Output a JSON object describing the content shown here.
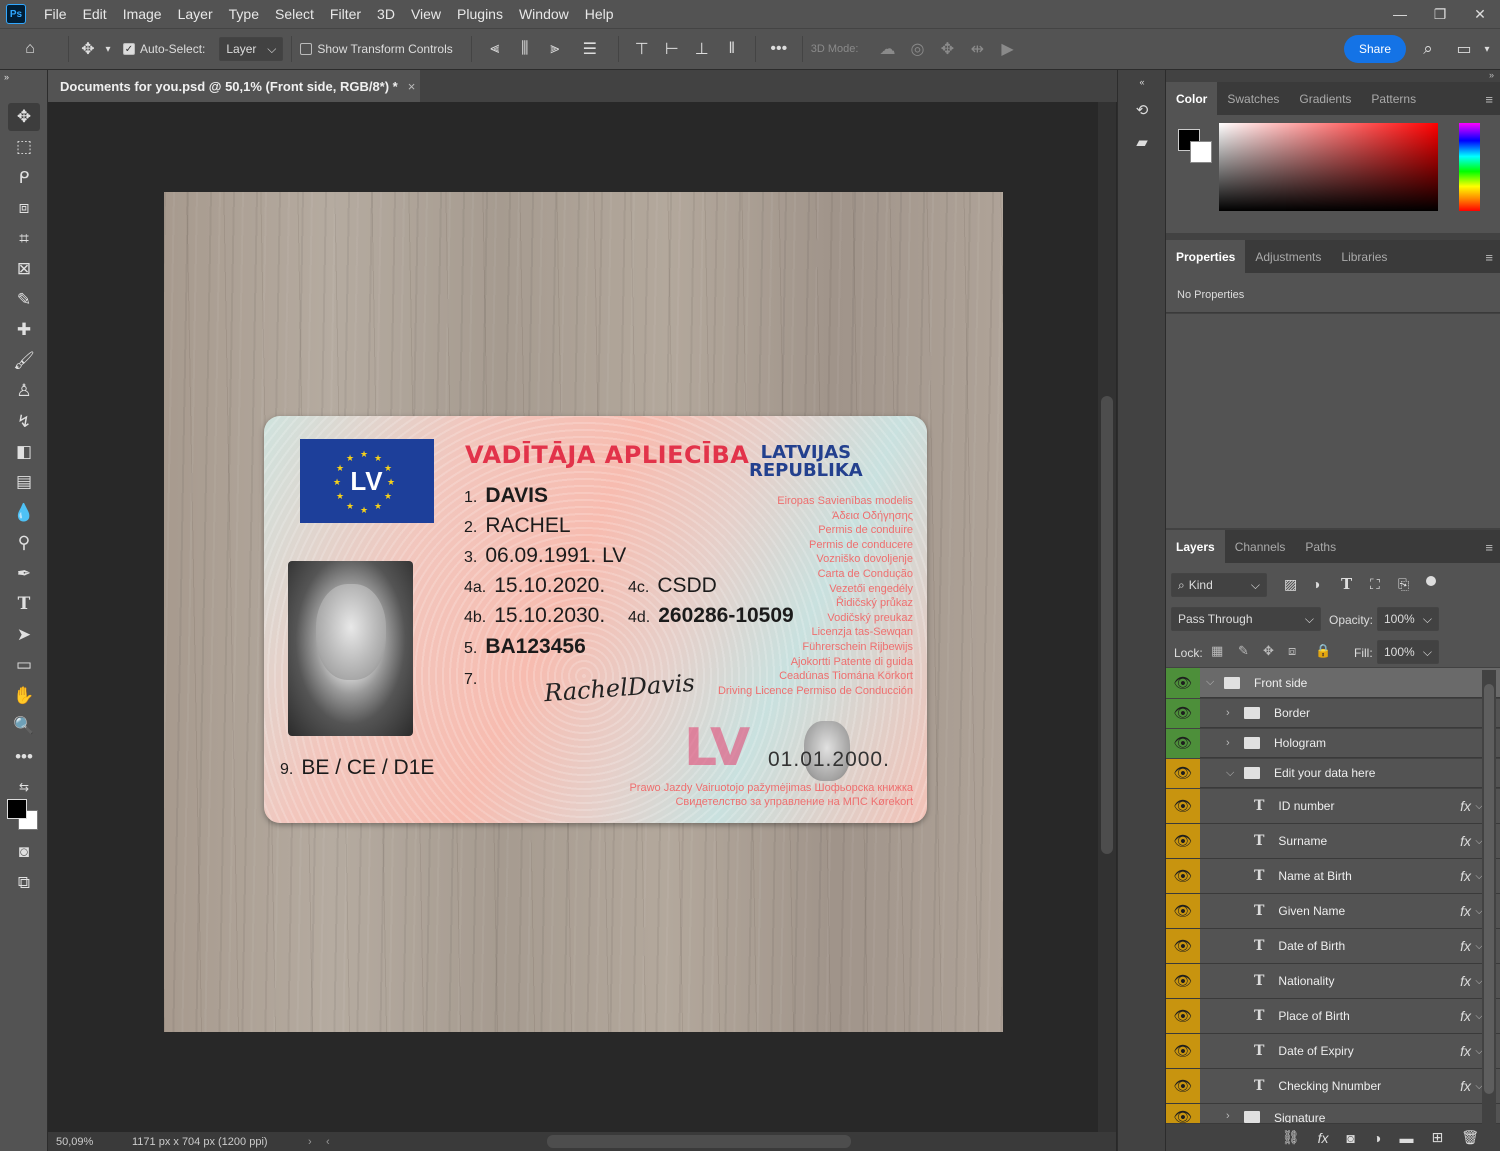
{
  "menubar": {
    "logo": "Ps",
    "items": [
      "File",
      "Edit",
      "Image",
      "Layer",
      "Type",
      "Select",
      "Filter",
      "3D",
      "View",
      "Plugins",
      "Window",
      "Help"
    ]
  },
  "options": {
    "auto_select_label": "Auto-Select:",
    "auto_select_value": "Layer",
    "show_transform_label": "Show Transform Controls",
    "mode3d_label": "3D Mode:",
    "share_label": "Share"
  },
  "document": {
    "tab_title": "Documents for you.psd @ 50,1% (Front side, RGB/8*) *",
    "zoom": "50,09%",
    "doc_size": "1171 px x 704 px (1200 ppi)"
  },
  "card": {
    "flag_text": "LV",
    "title_left": "VADĪTĀJA APLIECĪBA",
    "title_right_1": "LATVIJAS",
    "title_right_2": "REPUBLIKA",
    "f1_num": "1.",
    "f1_val": "DAVIS",
    "f2_num": "2.",
    "f2_val": "RACHEL",
    "f3_num": "3.",
    "f3_val": "06.09.1991. LV",
    "f4a_num": "4a.",
    "f4a_val": "15.10.2020.",
    "f4c_num": "4c.",
    "f4c_val": "CSDD",
    "f4b_num": "4b.",
    "f4b_val": "15.10.2030.",
    "f4d_num": "4d.",
    "f4d_val": "260286-10509",
    "f5_num": "5.",
    "f5_val": "BA123456",
    "f7_num": "7.",
    "f9_num": "9.",
    "f9_val": "BE / CE / D1E",
    "signature": "RachelDavis",
    "lv_hologram": "LV",
    "ghost_date": "01.01.2000.",
    "languages": [
      "Eiropas Savienības modelis",
      "Άδεια Οδήγησης",
      "Permis de conduire",
      "Permis de conducere",
      "Vozniško dovoljenje",
      "Carta de Condução",
      "Vezetői engedély",
      "Řidičský průkaz",
      "Vodičský preukaz",
      "Licenzja tas-Sewqan",
      "Führerschein  Rijbewijs",
      "Ajokortti  Patente di guida",
      "Ceadúnas Tiomána Körkort",
      "Driving Licence Permiso de Conducción"
    ],
    "bottom_lines": [
      "Prawo Jazdy Vairuotojo pažymėjimas Шофьорска книжка",
      "Свидетелство за управление на МПС  Kørekort"
    ]
  },
  "panels": {
    "color_tabs": [
      "Color",
      "Swatches",
      "Gradients",
      "Patterns"
    ],
    "props_tabs": [
      "Properties",
      "Adjustments",
      "Libraries"
    ],
    "no_properties": "No Properties",
    "layer_tabs": [
      "Layers",
      "Channels",
      "Paths"
    ],
    "kind_label": "Kind",
    "blend_mode": "Pass Through",
    "opacity_label": "Opacity:",
    "opacity_value": "100%",
    "lock_label": "Lock:",
    "fill_label": "Fill:",
    "fill_value": "100%",
    "layers": [
      {
        "name": "Front side",
        "type": "group",
        "eye": "g"
      },
      {
        "name": "Border",
        "type": "group",
        "eye": "g"
      },
      {
        "name": "Hologram",
        "type": "group",
        "eye": "g"
      },
      {
        "name": "Edit your data here",
        "type": "group",
        "eye": "y"
      },
      {
        "name": "ID number",
        "type": "text",
        "eye": "y"
      },
      {
        "name": "Surname",
        "type": "text",
        "eye": "y"
      },
      {
        "name": "Name at Birth",
        "type": "text",
        "eye": "y"
      },
      {
        "name": "Given Name",
        "type": "text",
        "eye": "y"
      },
      {
        "name": "Date of Birth",
        "type": "text",
        "eye": "y"
      },
      {
        "name": "Nationality",
        "type": "text",
        "eye": "y"
      },
      {
        "name": "Place of Birth",
        "type": "text",
        "eye": "y"
      },
      {
        "name": "Date of Expiry",
        "type": "text",
        "eye": "y"
      },
      {
        "name": "Checking Nnumber",
        "type": "text",
        "eye": "y"
      },
      {
        "name": "Signature",
        "type": "group",
        "eye": "y"
      }
    ]
  },
  "colors": {
    "accent": "#1473e6",
    "eye_green": "#4d8f3a",
    "eye_yellow": "#c8940f"
  }
}
